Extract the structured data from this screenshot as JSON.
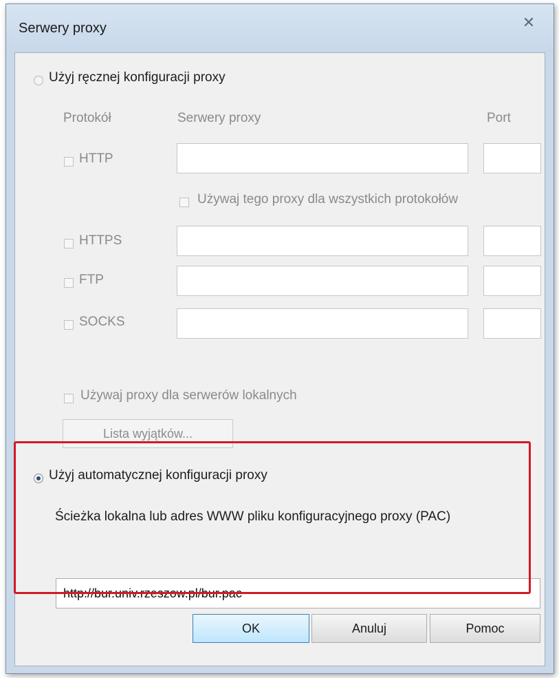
{
  "window": {
    "title": "Serwery proxy"
  },
  "manual": {
    "radio_label": "Użyj ręcznej konfiguracji proxy",
    "headers": {
      "protocol": "Protokół",
      "servers": "Serwery proxy",
      "port": "Port"
    },
    "rows": [
      {
        "label": "HTTP",
        "server": "",
        "port": ""
      },
      {
        "label": "HTTPS",
        "server": "",
        "port": ""
      },
      {
        "label": "FTP",
        "server": "",
        "port": ""
      },
      {
        "label": "SOCKS",
        "server": "",
        "port": ""
      }
    ],
    "use_for_all_label": "Używaj tego proxy dla wszystkich protokołów",
    "local_servers_label": "Używaj proxy dla serwerów lokalnych",
    "exceptions_button": "Lista wyjątków..."
  },
  "auto": {
    "radio_label": "Użyj automatycznej konfiguracji proxy",
    "description": "Ścieżka lokalna lub adres WWW pliku konfiguracyjnego proxy (PAC)",
    "pac_url": "http://bur.univ.rzeszow.pl/bur.pac",
    "selected": true
  },
  "buttons": {
    "ok": "OK",
    "cancel": "Anuluj",
    "help": "Pomoc"
  },
  "colors": {
    "highlight": "#d11a24",
    "dialog_frame": "#c9d9ea",
    "client_bg": "#f0f0f0"
  }
}
